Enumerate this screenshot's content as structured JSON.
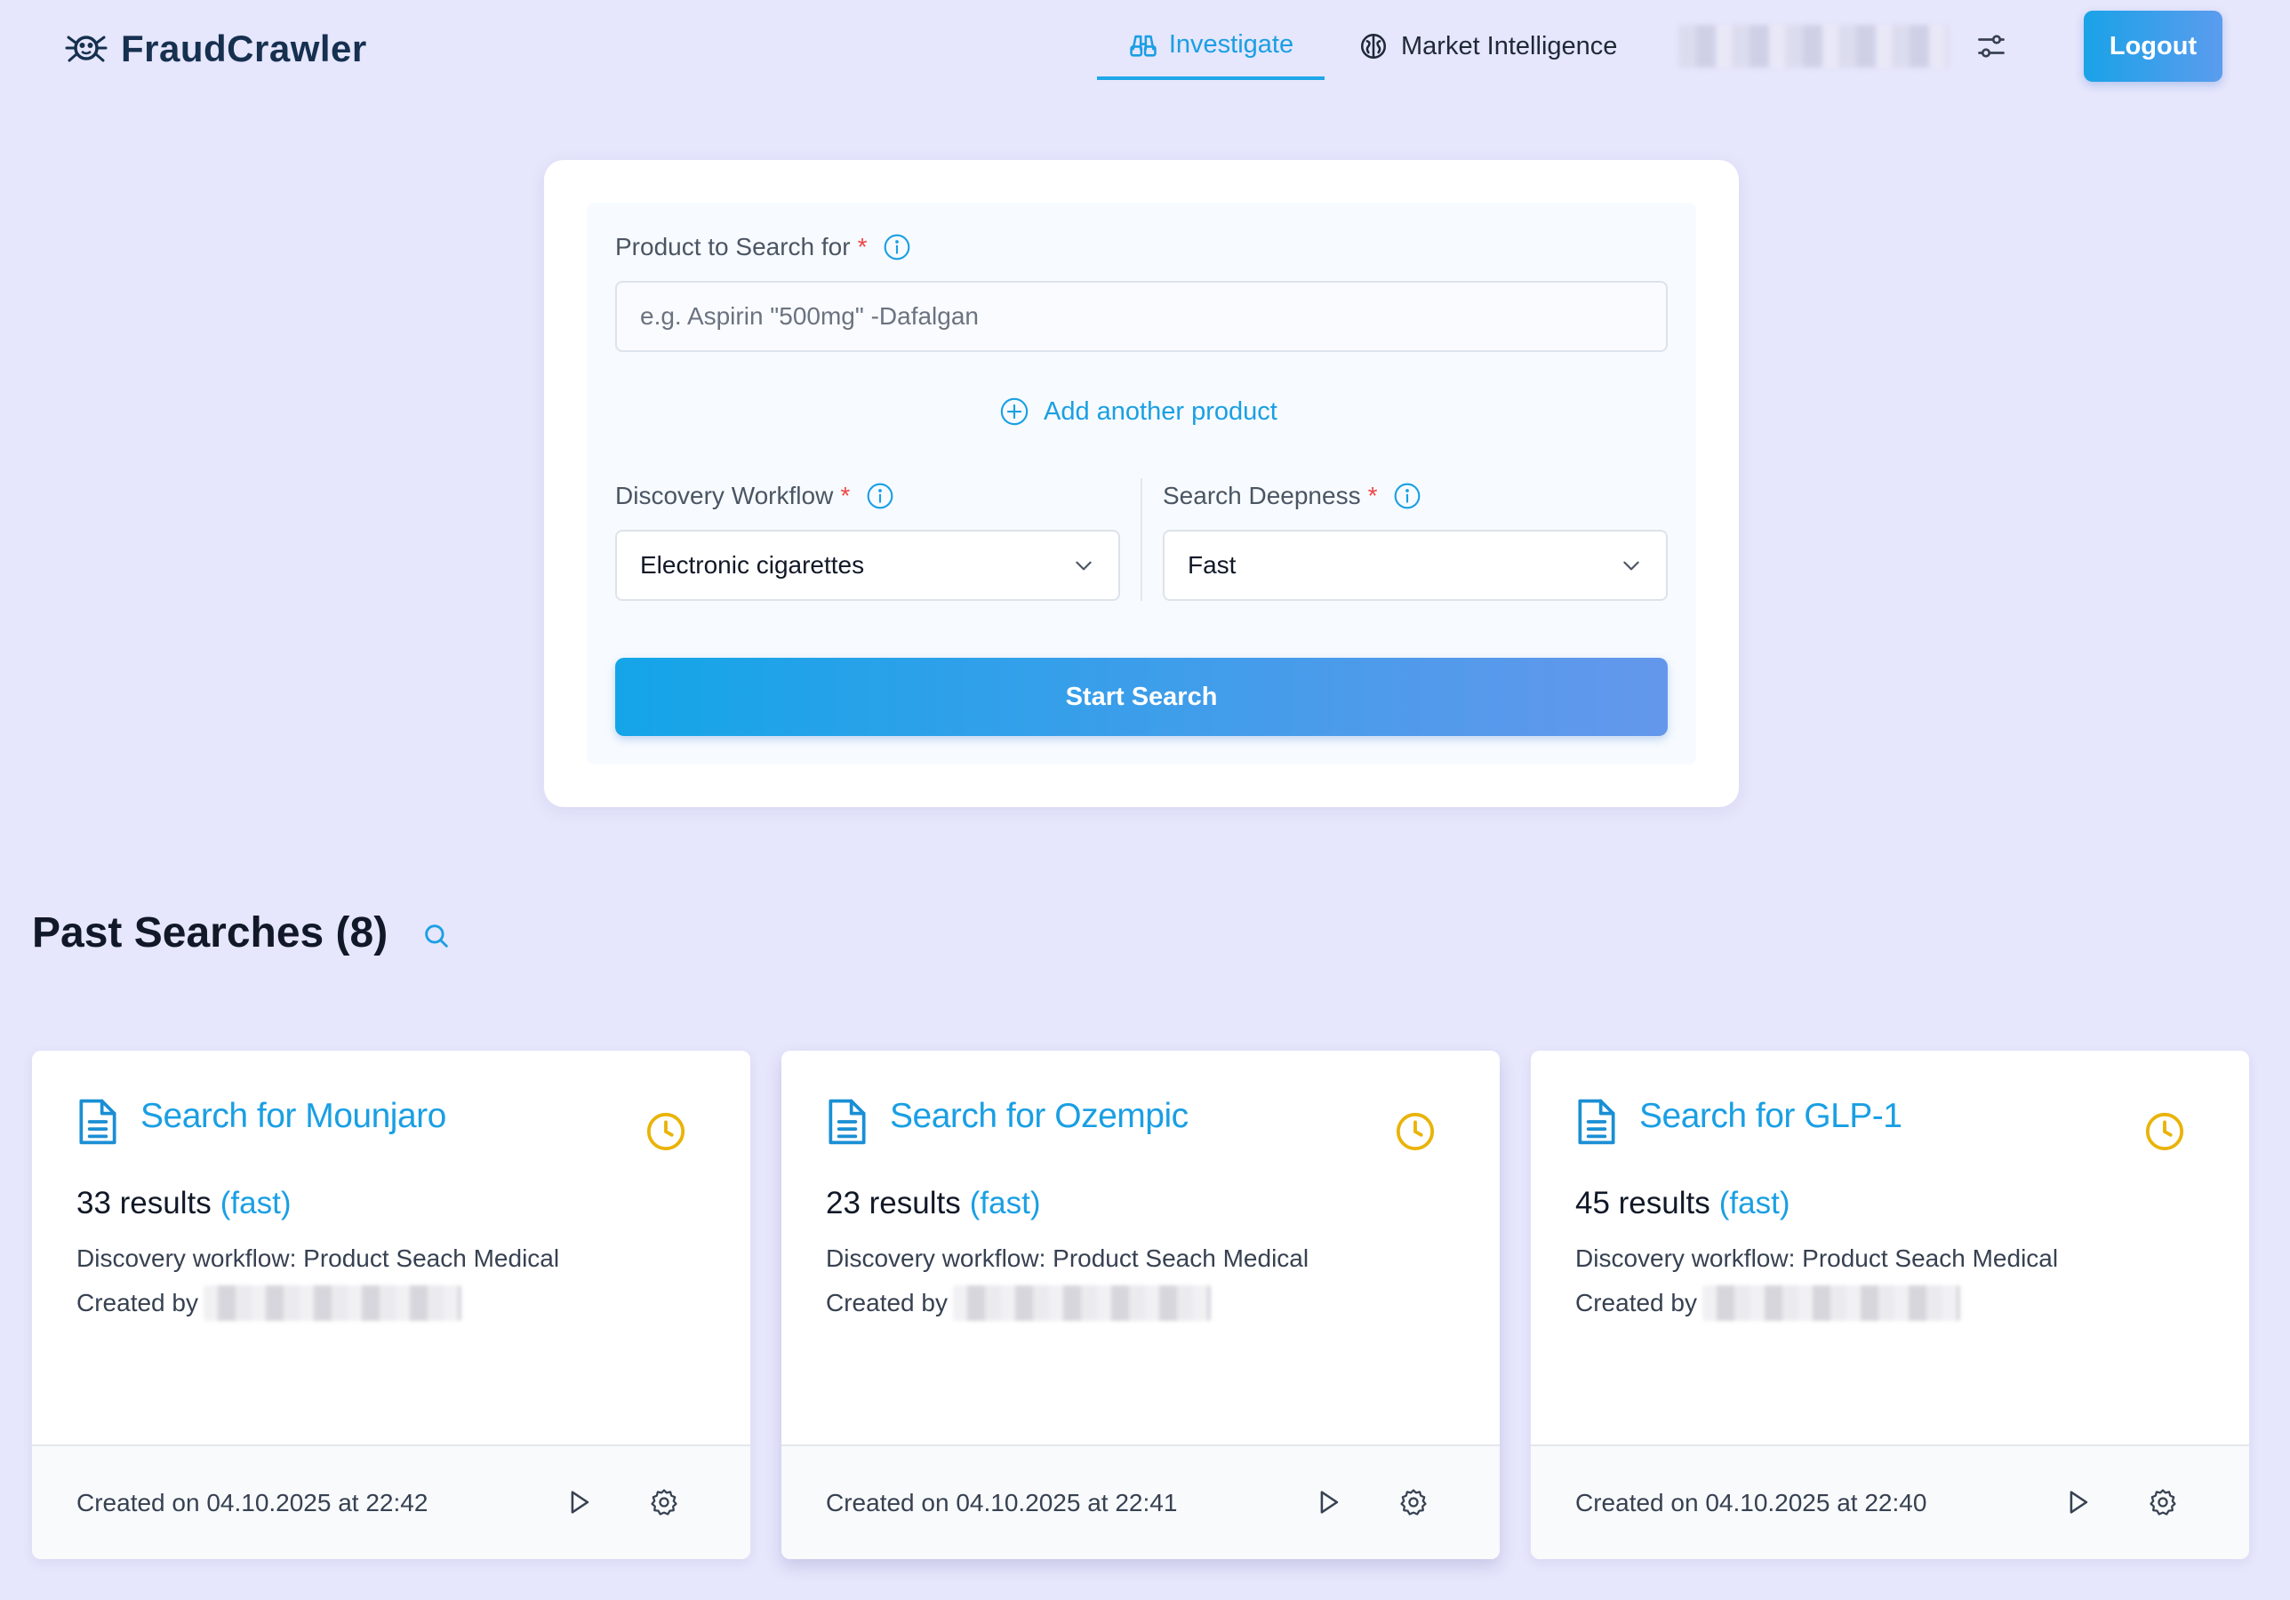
{
  "app": {
    "brand": "FraudCrawler",
    "accent_color": "#1a9fe3",
    "nav": {
      "investigate_label": "Investigate",
      "market_label": "Market Intelligence",
      "logout_label": "Logout"
    }
  },
  "search_form": {
    "product_label": "Product to Search for",
    "required_mark": "*",
    "product_placeholder": "e.g. Aspirin \"500mg\" -Dafalgan",
    "product_value": "",
    "add_product_label": "Add another product",
    "workflow_label": "Discovery Workflow",
    "workflow_value": "Electronic cigarettes",
    "deepness_label": "Search Deepness",
    "deepness_value": "Fast",
    "start_label": "Start Search"
  },
  "past_searches": {
    "title": "Past Searches (8)",
    "cards": [
      {
        "title": "Search for Mounjaro",
        "results": "33 results",
        "deepness": "(fast)",
        "workflow": "Discovery workflow: Product Seach Medical",
        "created_by_label": "Created by",
        "created_on": "Created on 04.10.2025 at 22:42"
      },
      {
        "title": "Search for Ozempic",
        "results": "23 results",
        "deepness": "(fast)",
        "workflow": "Discovery workflow: Product Seach Medical",
        "created_by_label": "Created by",
        "created_on": "Created on 04.10.2025 at 22:41"
      },
      {
        "title": "Search for GLP-1",
        "results": "45 results",
        "deepness": "(fast)",
        "workflow": "Discovery workflow: Product Seach Medical",
        "created_by_label": "Created by",
        "created_on": "Created on 04.10.2025 at 22:40"
      }
    ]
  }
}
